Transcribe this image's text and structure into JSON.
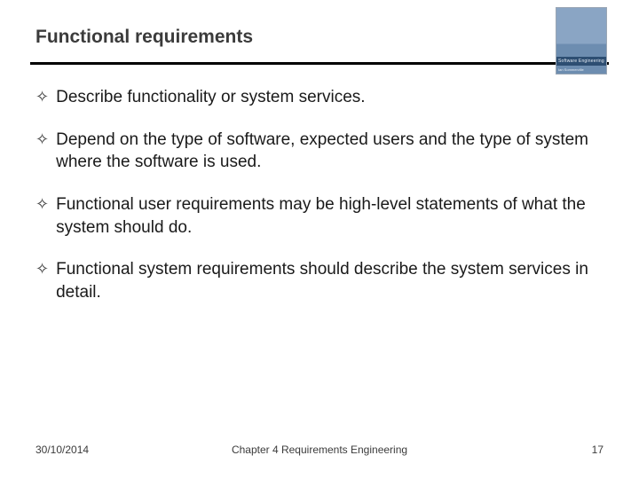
{
  "header": {
    "title": "Functional requirements",
    "book_label": "Software Engineering",
    "book_sub": "Ian Sommerville"
  },
  "bullets": [
    {
      "text": "Describe functionality or system services."
    },
    {
      "text": "Depend on the type of software, expected users and the type of system where the software is used."
    },
    {
      "text": "Functional user requirements may be high-level statements of what the system should do."
    },
    {
      "text": "Functional system requirements should describe the system services in detail."
    }
  ],
  "footer": {
    "date": "30/10/2014",
    "chapter": "Chapter 4 Requirements Engineering",
    "page": "17"
  }
}
